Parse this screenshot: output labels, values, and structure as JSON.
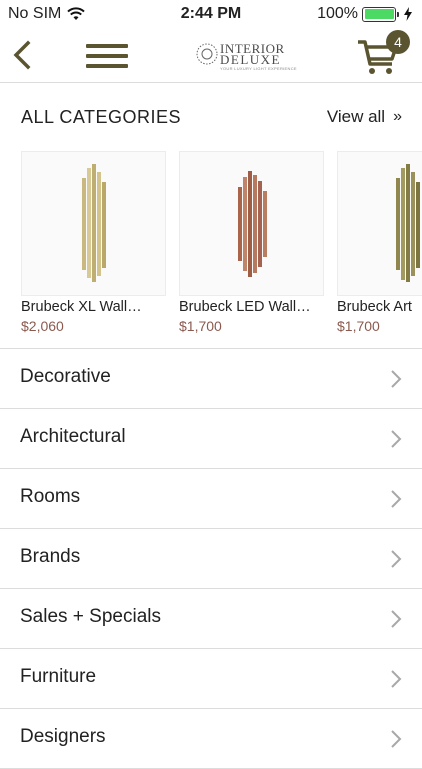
{
  "status": {
    "carrier": "No SIM",
    "time": "2:44 PM",
    "battery": "100%"
  },
  "nav": {
    "logo_line1": "INTERIOR",
    "logo_line2": "DELUXE",
    "logo_tagline": "YOUR LUXURY LIGHT EXPERIENCE",
    "cart_count": "4"
  },
  "section": {
    "title": "ALL CATEGORIES",
    "view_all": "View all",
    "view_all_arrow": "»"
  },
  "products": [
    {
      "name": "Brubeck XL Wall…",
      "price": "$2,060",
      "color": "#c9b880"
    },
    {
      "name": "Brubeck LED Wall…",
      "price": "$1,700",
      "color": "#b0725a"
    },
    {
      "name": "Brubeck Art",
      "price": "$1,700",
      "color": "#8f874e"
    }
  ],
  "categories": [
    "Decorative",
    "Architectural",
    "Rooms",
    "Brands",
    "Sales + Specials",
    "Furniture",
    "Designers"
  ],
  "colors": {
    "accent": "#5a5530",
    "price": "#8b5a4f",
    "battery": "#4cd964"
  }
}
